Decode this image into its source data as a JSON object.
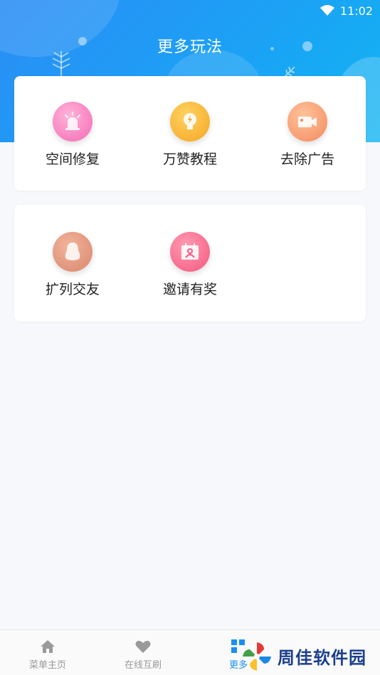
{
  "status_bar": {
    "time": "11:02",
    "wifi_icon": "wifi-icon"
  },
  "header": {
    "title": "更多玩法"
  },
  "card1": {
    "items": [
      {
        "label": "空间修复",
        "icon": "alarm-light-icon",
        "color": "#f56ab6"
      },
      {
        "label": "万赞教程",
        "icon": "lightbulb-icon",
        "color": "#f5a623"
      },
      {
        "label": "去除广告",
        "icon": "video-camera-icon",
        "color": "#f38a5f"
      }
    ]
  },
  "card2": {
    "items": [
      {
        "label": "扩列交友",
        "icon": "qq-penguin-icon",
        "color": "#d9876c"
      },
      {
        "label": "邀请有奖",
        "icon": "calendar-person-icon",
        "color": "#f5577e"
      }
    ]
  },
  "tabbar": {
    "tabs": [
      {
        "label": "菜单主页",
        "icon": "home-icon",
        "active": false
      },
      {
        "label": "在线互刷",
        "icon": "heart-icon",
        "active": false
      },
      {
        "label": "更多",
        "icon": "grid-icon",
        "active": true
      }
    ],
    "active_color": "#1a8ef5",
    "inactive_color": "#999999"
  },
  "watermark": {
    "text": "周佳软件园",
    "icon": "pinwheel-logo-icon"
  }
}
